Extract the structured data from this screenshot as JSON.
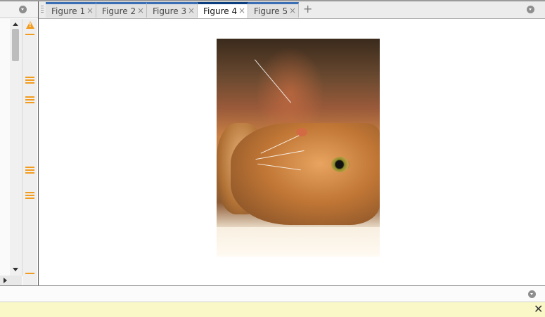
{
  "tabs": [
    {
      "label": "Figure 1",
      "active": false
    },
    {
      "label": "Figure 2",
      "active": false
    },
    {
      "label": "Figure 3",
      "active": false
    },
    {
      "label": "Figure 4",
      "active": true
    },
    {
      "label": "Figure 5",
      "active": false
    }
  ],
  "tab_close_glyph": "×",
  "add_tab_glyph": "+",
  "notice_close_glyph": "✕",
  "warning_glyph": "!",
  "icons": {
    "left_panel_menu": "chevron-down-icon",
    "tab_menu": "chevron-down-icon",
    "bottom_menu": "chevron-down-icon",
    "warning": "warning-icon",
    "markers": "warning-marker-icon"
  },
  "figure": {
    "image_subject": "cat"
  },
  "colors": {
    "accent_tab": "#3a6fb5",
    "active_tab_accent": "#0b3f7f",
    "warning": "#f29c1f",
    "notice_bg": "#fbf8c7"
  }
}
